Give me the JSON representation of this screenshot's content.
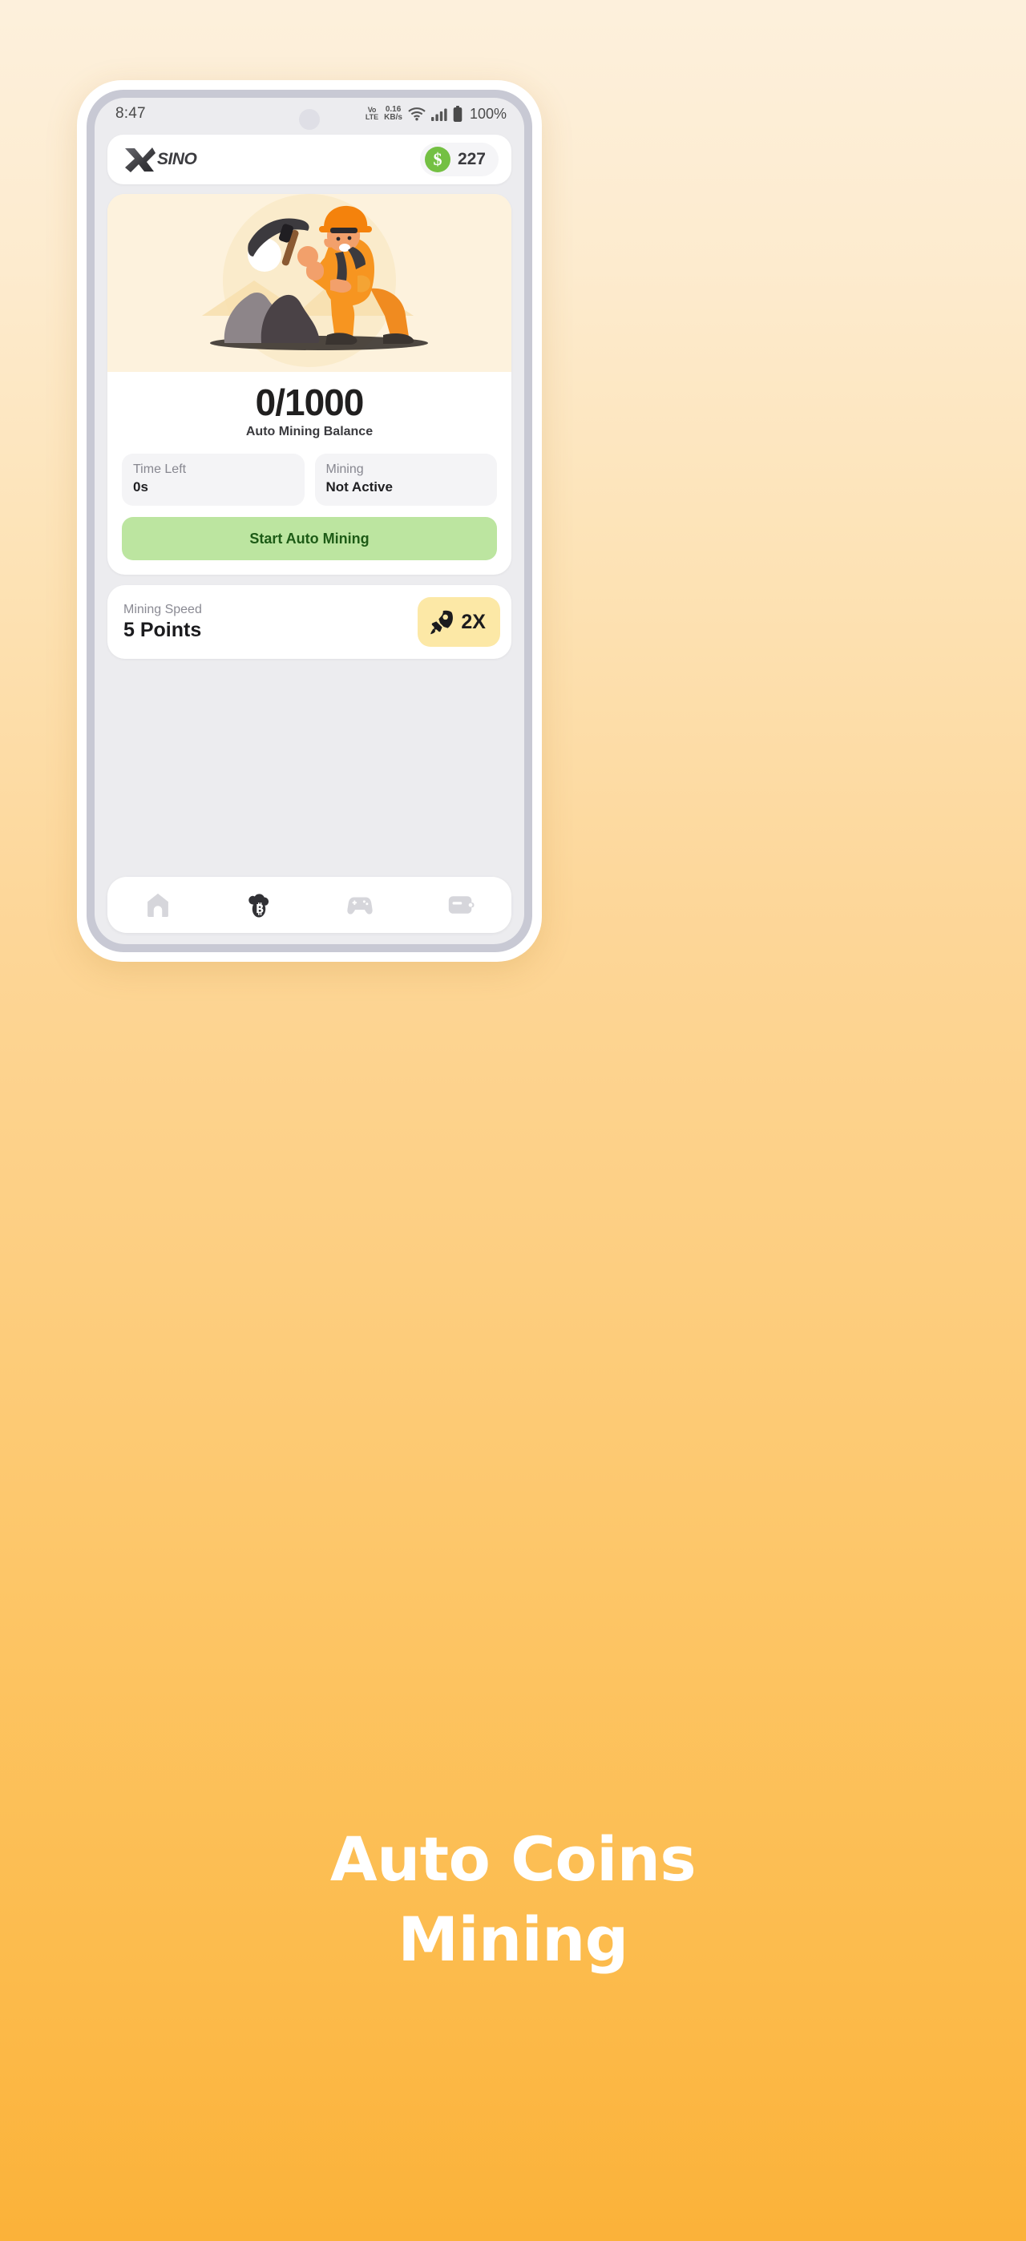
{
  "background": {
    "gradient_top": "#FDF0DC",
    "gradient_bottom": "#FBB239"
  },
  "phone": {
    "frame_color": "#FFFFFF",
    "bezel_color": "#C8C9D4",
    "screen_background": "#ECECEF"
  },
  "status_bar": {
    "time": "8:47",
    "volte_line1": "Vo",
    "volte_line2": "LTE",
    "network_speed_value": "0.16",
    "network_speed_unit": "KB/s",
    "wifi_icon": "wifi-icon",
    "signal_icon": "cellular-signal-icon",
    "battery_icon": "battery-full-icon",
    "battery_text": "100%",
    "camera_icon": "front-camera-punch-hole"
  },
  "header": {
    "logo_icon": "xsino-x-logo-icon",
    "brand_name": "SINO",
    "coin_icon": "dollar-coin-icon",
    "coin_color": "#74C043",
    "coin_amount": "227"
  },
  "main_card": {
    "illustration_name": "miner-with-pickaxe-illustration",
    "illustration_background": "#FDF2DD",
    "balance_value": "0/1000",
    "balance_label": "Auto Mining Balance",
    "stats": [
      {
        "label": "Time Left",
        "value": "0s",
        "name": "time-left"
      },
      {
        "label": "Mining",
        "value": "Not Active",
        "name": "mining-status"
      }
    ],
    "start_button_label": "Start Auto Mining",
    "start_button_bg": "#BCE5A0",
    "start_button_text_color": "#1D5B16"
  },
  "speed_card": {
    "label": "Mining Speed",
    "value": "5 Points",
    "badge_icon": "rocket-icon",
    "badge_text": "2X",
    "badge_bg": "#FCE8A6"
  },
  "bottom_nav": {
    "items": [
      {
        "name": "nav-home",
        "icon": "home-icon",
        "active": false
      },
      {
        "name": "nav-cloud-mining",
        "icon": "cloud-bitcoin-icon",
        "active": true
      },
      {
        "name": "nav-games",
        "icon": "gamepad-icon",
        "active": false
      },
      {
        "name": "nav-wallet",
        "icon": "wallet-icon",
        "active": false
      }
    ],
    "inactive_color": "#D6D6DB",
    "active_color": "#313135"
  },
  "headline": {
    "line1": "Auto Coins",
    "line2": "Mining",
    "color": "#FFFFFF"
  }
}
